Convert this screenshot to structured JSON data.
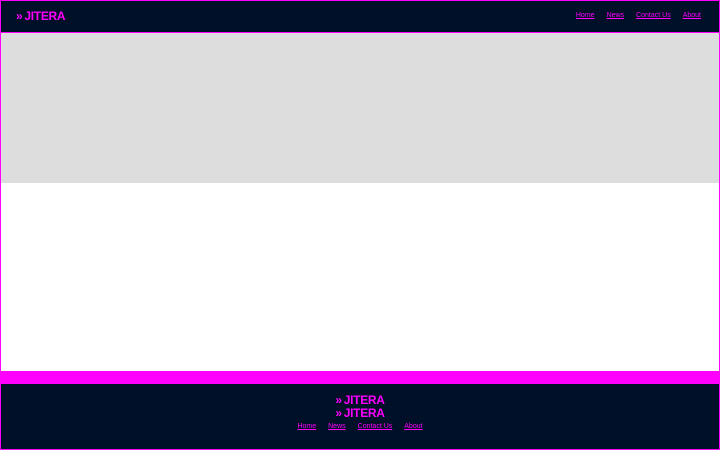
{
  "brand": {
    "name": "JITERA",
    "icon": "double-chevron-right-icon"
  },
  "header": {
    "nav": [
      "Home",
      "News",
      "Contact Us",
      "About"
    ]
  },
  "footer": {
    "logo_lines": [
      "JITERA",
      "JITERA"
    ],
    "nav": [
      "Home",
      "News",
      "Contact Us",
      "About"
    ]
  },
  "colors": {
    "header_bg": "#001028",
    "accent": "#ff00ff",
    "hero_bg": "#dddddd",
    "content_bg": "#ffffff"
  }
}
